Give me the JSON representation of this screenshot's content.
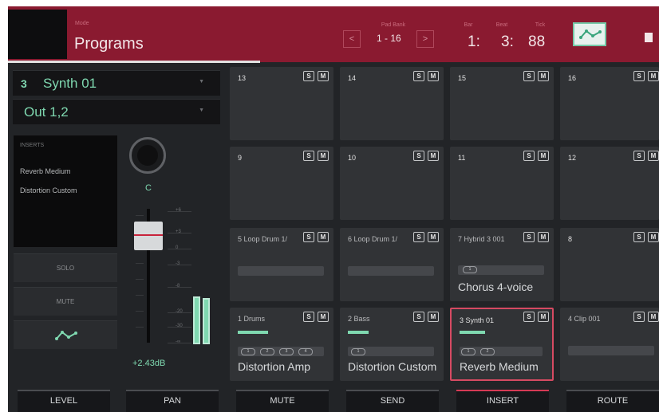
{
  "header": {
    "mode_small": "Mode",
    "title": "Programs",
    "bank_small": "Pad Bank",
    "bank_prev": "<",
    "bank_value": "1 - 16",
    "bank_next": ">",
    "bar_small": "Bar",
    "beat_small": "Beat",
    "tick_small": "Tick",
    "bar": "1:",
    "beat": "3:",
    "tick": "88"
  },
  "left": {
    "program_number": "3",
    "program_name": "Synth 01",
    "output": "Out 1,2",
    "inserts_title": "INSERTS",
    "inserts": [
      "Reverb Medium",
      "Distortion Custom"
    ],
    "solo": "SOLO",
    "mute": "MUTE",
    "pan_value": "C",
    "fader_ticks": [
      "+6",
      "+3",
      "0",
      "-3",
      "-8",
      "-20",
      "-30",
      "-∞"
    ],
    "level_value": "+2.43dB"
  },
  "pads": [
    {
      "label": "13",
      "solo": "S",
      "mute": "M"
    },
    {
      "label": "14",
      "solo": "S",
      "mute": "M"
    },
    {
      "label": "15",
      "solo": "S",
      "mute": "M"
    },
    {
      "label": "16",
      "solo": "S",
      "mute": "M"
    },
    {
      "label": "9",
      "solo": "S",
      "mute": "M"
    },
    {
      "label": "10",
      "solo": "S",
      "mute": "M"
    },
    {
      "label": "11",
      "solo": "S",
      "mute": "M"
    },
    {
      "label": "12",
      "solo": "S",
      "mute": "M"
    },
    {
      "label": "5 Loop Drum 1/",
      "solo": "S",
      "mute": "M"
    },
    {
      "label": "6 Loop Drum 1/",
      "solo": "S",
      "mute": "M"
    },
    {
      "label": "7 Hybrid 3 001",
      "solo": "S",
      "mute": "M",
      "slot": "1",
      "insert": "Chorus 4-voice"
    },
    {
      "label": "8",
      "solo": "S",
      "mute": "M"
    },
    {
      "label": "1 Drums",
      "solo": "S",
      "mute": "M",
      "slots": [
        "1",
        "2",
        "3",
        "4"
      ],
      "insert": "Distortion Amp"
    },
    {
      "label": "2 Bass",
      "solo": "S",
      "mute": "M",
      "slots": [
        "1"
      ],
      "insert": "Distortion Custom"
    },
    {
      "label": "3 Synth 01",
      "solo": "S",
      "mute": "M",
      "slots": [
        "1",
        "2"
      ],
      "insert": "Reverb Medium"
    },
    {
      "label": "4 Clip 001",
      "solo": "S",
      "mute": "M"
    }
  ],
  "tabs": [
    "LEVEL",
    "PAN",
    "MUTE",
    "SEND",
    "INSERT",
    "ROUTE"
  ],
  "active_tab": "INSERT",
  "colors": {
    "accent": "#8a1a30",
    "green": "#7fd8b0",
    "selected_outline": "#d64a62"
  }
}
